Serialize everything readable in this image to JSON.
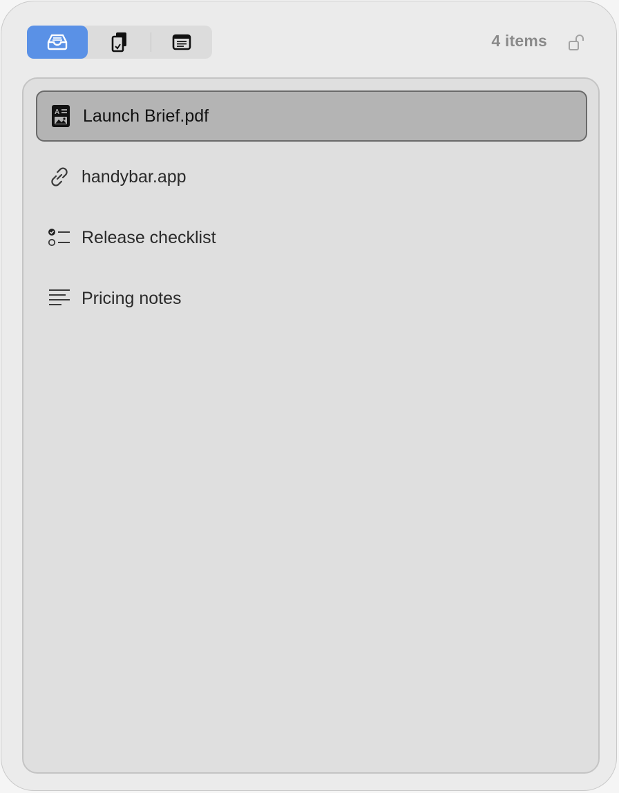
{
  "toolbar": {
    "tabs": [
      {
        "name": "inbox",
        "icon": "tray-icon",
        "active": true
      },
      {
        "name": "clipboard",
        "icon": "copy-documents-icon",
        "active": false
      },
      {
        "name": "notes",
        "icon": "note-window-icon",
        "active": false
      }
    ],
    "accent_color": "#5a91e6"
  },
  "header": {
    "item_count": "4 items",
    "lock_icon": "unlocked-padlock-icon"
  },
  "list": {
    "items": [
      {
        "label": "Launch Brief.pdf",
        "icon": "document-icon",
        "selected": true
      },
      {
        "label": "handybar.app",
        "icon": "link-icon",
        "selected": false
      },
      {
        "label": "Release checklist",
        "icon": "checklist-icon",
        "selected": false
      },
      {
        "label": "Pricing notes",
        "icon": "text-lines-icon",
        "selected": false
      }
    ]
  }
}
